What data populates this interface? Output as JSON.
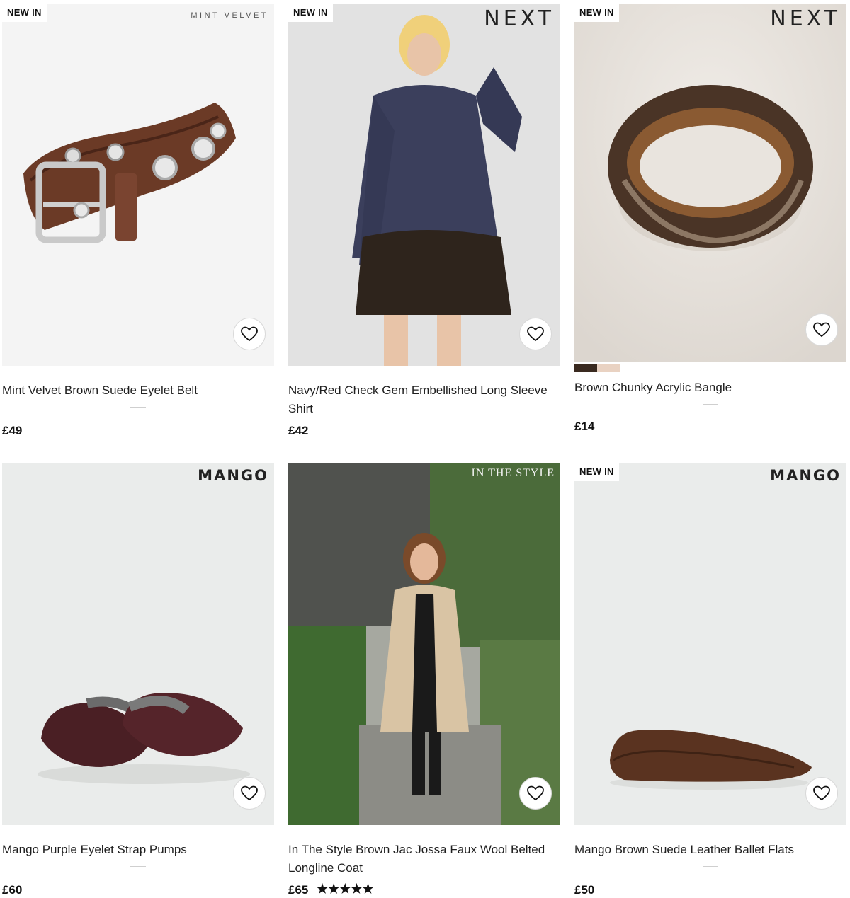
{
  "products": [
    {
      "badge": "NEW IN",
      "brand": "MINT VELVET",
      "title": "Mint Velvet Brown Suede Eyelet Belt",
      "price": "£49",
      "image_alt": "brown suede eyelet belt",
      "icon": "heart-icon"
    },
    {
      "badge": "NEW IN",
      "brand": "NEXT",
      "title": "Navy/Red Check Gem Embellished Long Sleeve Shirt",
      "price": "£42",
      "image_alt": "model in navy check shirt and black mini skirt",
      "icon": "heart-icon"
    },
    {
      "badge": "NEW IN",
      "brand": "NEXT",
      "title": "Brown Chunky Acrylic Bangle",
      "price": "£14",
      "image_alt": "brown marbled acrylic bangle",
      "swatches": [
        "#3a2a20",
        "#e9d2c2"
      ],
      "icon": "heart-icon"
    },
    {
      "badge": "",
      "brand": "MANGO",
      "title": "Mango Purple Eyelet Strap Pumps",
      "price": "£60",
      "image_alt": "burgundy leather pumps with studded eyelet strap",
      "icon": "heart-icon"
    },
    {
      "badge": "",
      "brand": "IN THE STYLE",
      "title": "In The Style Brown Jac Jossa Faux Wool Belted Longline Coat",
      "price": "£65",
      "rating_stars": "★★★★★",
      "rating": 5,
      "image_alt": "woman in beige longline coat in garden",
      "icon": "heart-icon"
    },
    {
      "badge": "NEW IN",
      "brand": "MANGO",
      "title": "Mango Brown Suede Leather Ballet Flats",
      "price": "£50",
      "image_alt": "brown suede ballet flat",
      "icon": "heart-icon"
    }
  ]
}
